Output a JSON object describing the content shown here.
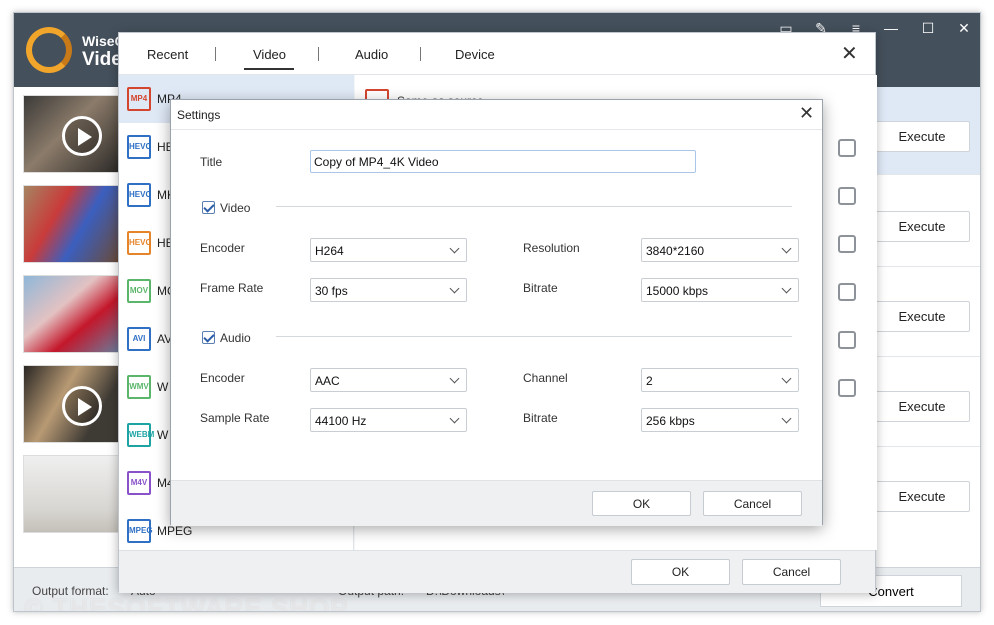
{
  "app": {
    "brand_line1": "WiseCl",
    "brand_line2": "Vide",
    "close_small": "×"
  },
  "main": {
    "execute_buttons": [
      "Execute",
      "Execute",
      "Execute",
      "Execute",
      "Execute"
    ],
    "output_format_label": "Output format:",
    "output_format_value": "Auto",
    "output_path_label": "Output path:",
    "output_path_value": "D:\\Downloads\\",
    "convert_label": "Convert",
    "watermark": "© THESOFTWARE.SHOP"
  },
  "format_dialog": {
    "tabs": [
      "Recent",
      "Video",
      "Audio",
      "Device"
    ],
    "active_tab": "Video",
    "close": "✕",
    "formats": [
      {
        "icon": "MP4",
        "name": "MP4",
        "color": "#d4452e"
      },
      {
        "icon": "HEVC",
        "name": "HE",
        "color": "#2f6fc4"
      },
      {
        "icon": "HEVC",
        "name": "MK",
        "color": "#2f6fc4"
      },
      {
        "icon": "HEVC",
        "name": "HE",
        "color": "#e6842a"
      },
      {
        "icon": "MOV",
        "name": "MO",
        "color": "#5bb56a"
      },
      {
        "icon": "AVI",
        "name": "AV",
        "color": "#2f6fc4"
      },
      {
        "icon": "WMV",
        "name": "W",
        "color": "#5bb56a"
      },
      {
        "icon": "WEBM",
        "name": "W",
        "color": "#1ea3a3"
      },
      {
        "icon": "M4V",
        "name": "M4",
        "color": "#8a52c9"
      },
      {
        "icon": "MPEG",
        "name": "MPEG",
        "color": "#2f6fc4"
      }
    ],
    "preset_label": "Same as source",
    "ok_label": "OK",
    "cancel_label": "Cancel"
  },
  "settings": {
    "title": "Settings",
    "close": "✕",
    "title_label": "Title",
    "title_value": "Copy of MP4_4K Video",
    "video_label": "Video",
    "audio_label": "Audio",
    "encoder_label": "Encoder",
    "encoder_value": "H264",
    "resolution_label": "Resolution",
    "resolution_value": "3840*2160",
    "frame_rate_label": "Frame Rate",
    "frame_rate_value": "30 fps",
    "video_bitrate_label": "Bitrate",
    "video_bitrate_value": "15000 kbps",
    "audio_encoder_label": "Encoder",
    "audio_encoder_value": "AAC",
    "channel_label": "Channel",
    "channel_value": "2",
    "sample_rate_label": "Sample Rate",
    "sample_rate_value": "44100 Hz",
    "audio_bitrate_label": "Bitrate",
    "audio_bitrate_value": "256 kbps",
    "ok_label": "OK",
    "cancel_label": "Cancel"
  }
}
